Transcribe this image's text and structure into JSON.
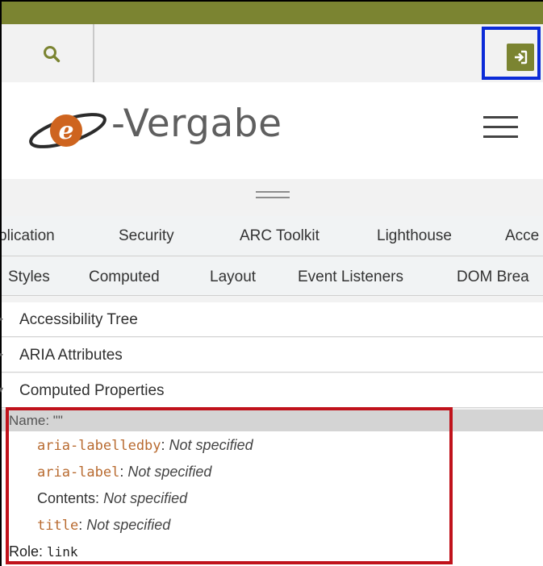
{
  "header": {
    "search_icon": "search-icon",
    "login_icon": "sign-in-icon",
    "brand_color": "#7b8431",
    "logo_text": "-Vergabe",
    "logo_letter": "e",
    "menu_icon": "hamburger-icon"
  },
  "devtools": {
    "panel_tabs": [
      "plication",
      "Security",
      "ARC Toolkit",
      "Lighthouse",
      "Acce"
    ],
    "sub_tabs": [
      "Styles",
      "Computed",
      "Layout",
      "Event Listeners",
      "DOM Brea"
    ],
    "sections": [
      {
        "label": "Accessibility Tree",
        "arrow": "▸"
      },
      {
        "label": "ARIA Attributes",
        "arrow": "▸"
      },
      {
        "label": "Computed Properties",
        "arrow": "▾"
      }
    ],
    "computed": {
      "name_label": "Name: \"\"",
      "props": [
        {
          "key": "aria-labelledby",
          "sep": ": ",
          "value": "Not specified"
        },
        {
          "key": "aria-label",
          "sep": ": ",
          "value": "Not specified"
        },
        {
          "key": "Contents",
          "sep": ": ",
          "value": "Not specified"
        },
        {
          "key": "title",
          "sep": ": ",
          "value": "Not specified"
        }
      ],
      "role_label": "Role: ",
      "role_value": "link"
    }
  },
  "highlight_colors": {
    "login": "#0b2bd8",
    "properties": "#c0121b"
  }
}
